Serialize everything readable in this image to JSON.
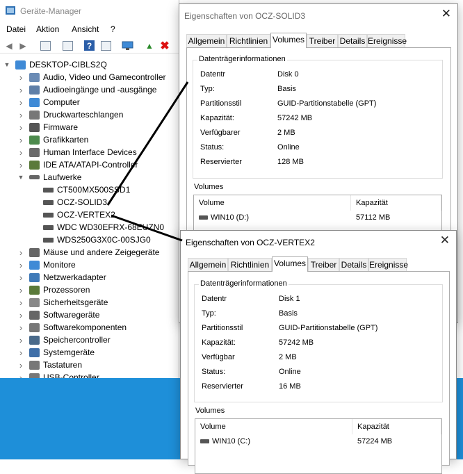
{
  "device_manager": {
    "title": "Geräte-Manager",
    "menu": [
      "Datei",
      "Aktion",
      "Ansicht",
      "?"
    ],
    "root": "DESKTOP-CIBLS2Q",
    "categories": [
      {
        "label": "Audio, Video und Gamecontroller",
        "color": "#6a8bb5"
      },
      {
        "label": "Audioeingänge und -ausgänge",
        "color": "#5f7fa8"
      },
      {
        "label": "Computer",
        "color": "#3f8ad6"
      },
      {
        "label": "Druckwarteschlangen",
        "color": "#777"
      },
      {
        "label": "Firmware",
        "color": "#555"
      },
      {
        "label": "Grafikkarten",
        "color": "#4c8a4c"
      },
      {
        "label": "Human Interface Devices",
        "color": "#6a6a6a"
      },
      {
        "label": "IDE ATA/ATAPI-Controller",
        "color": "#5a7a3a"
      }
    ],
    "expanded_category": "Laufwerke",
    "drives": [
      "CT500MX500SSD1",
      "OCZ-SOLID3",
      "OCZ-VERTEX2",
      "WDC WD30EFRX-68EUZN0",
      "WDS250G3X0C-00SJG0"
    ],
    "categories_after": [
      {
        "label": "Mäuse und andere Zeigegeräte",
        "color": "#666"
      },
      {
        "label": "Monitore",
        "color": "#3f8ad6"
      },
      {
        "label": "Netzwerkadapter",
        "color": "#3f7ab8"
      },
      {
        "label": "Prozessoren",
        "color": "#5a7a3a"
      },
      {
        "label": "Sicherheitsgeräte",
        "color": "#888"
      },
      {
        "label": "Softwaregeräte",
        "color": "#666"
      },
      {
        "label": "Softwarekomponenten",
        "color": "#777"
      },
      {
        "label": "Speichercontroller",
        "color": "#4a6a8a"
      },
      {
        "label": "Systemgeräte",
        "color": "#3f6fa8"
      },
      {
        "label": "Tastaturen",
        "color": "#777"
      },
      {
        "label": "USB-Controller",
        "color": "#777"
      }
    ]
  },
  "tab_labels": [
    "Allgemein",
    "Richtlinien",
    "Volumes",
    "Treiber",
    "Details",
    "Ereignisse"
  ],
  "dialog1": {
    "title": "Eigenschaften von OCZ-SOLID3",
    "group_title": "Datenträgerinformationen",
    "fields": [
      {
        "k": "Datentr",
        "v": "Disk 0"
      },
      {
        "k": "Typ:",
        "v": "Basis"
      },
      {
        "k": "Partitionsstil",
        "v": "GUID-Partitionstabelle (GPT)"
      },
      {
        "k": "Kapazität:",
        "v": "57242 MB"
      },
      {
        "k": "Verfügbarer",
        "v": "2 MB"
      },
      {
        "k": "Status:",
        "v": "Online"
      },
      {
        "k": "Reservierter",
        "v": "128 MB"
      }
    ],
    "volumes_label": "Volumes",
    "col_volume": "Volume",
    "col_capacity": "Kapazität",
    "volume_name": "WIN10 (D:)",
    "volume_capacity": "57112 MB"
  },
  "dialog2": {
    "title": "Eigenschaften von OCZ-VERTEX2",
    "group_title": "Datenträgerinformationen",
    "fields": [
      {
        "k": "Datentr",
        "v": "Disk 1"
      },
      {
        "k": "Typ:",
        "v": "Basis"
      },
      {
        "k": "Partitionsstil",
        "v": "GUID-Partitionstabelle (GPT)"
      },
      {
        "k": "Kapazität:",
        "v": "57242 MB"
      },
      {
        "k": "Verfügbar",
        "v": "2 MB"
      },
      {
        "k": "Status:",
        "v": "Online"
      },
      {
        "k": "Reservierter",
        "v": "16 MB"
      }
    ],
    "volumes_label": "Volumes",
    "col_volume": "Volume",
    "col_capacity": "Kapazität",
    "volume_name": "WIN10 (C:)",
    "volume_capacity": "57224 MB"
  },
  "colors": {
    "taskbar": "#1e8fd9",
    "delete": "#d11",
    "help": "#2b5ea8"
  }
}
